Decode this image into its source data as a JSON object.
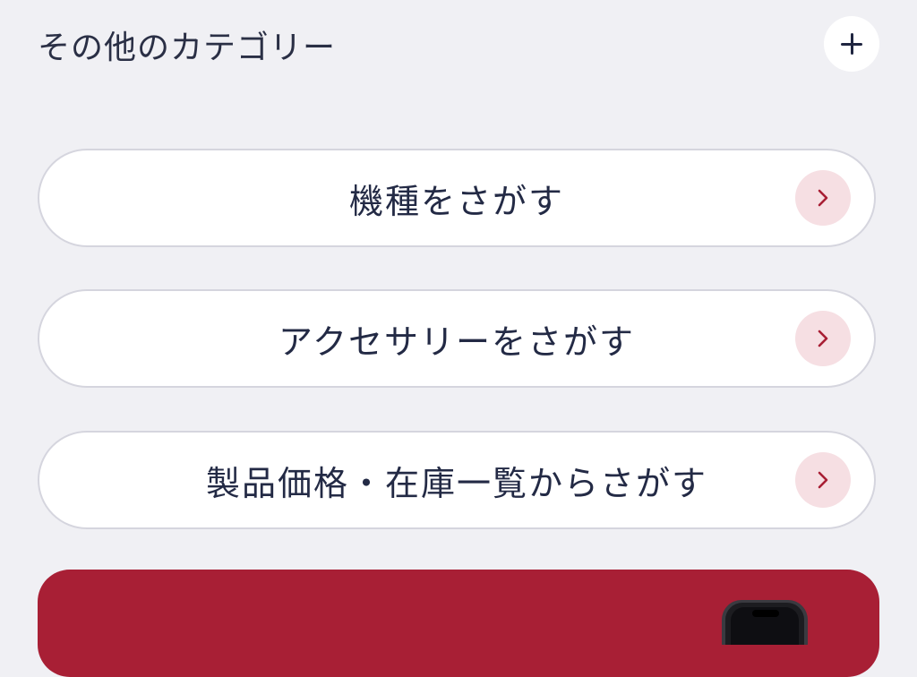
{
  "section": {
    "title": "その他のカテゴリー",
    "expand_icon": "plus-icon"
  },
  "nav_buttons": [
    {
      "label": "機種をさがす",
      "icon": "chevron-right-icon"
    },
    {
      "label": "アクセサリーをさがす",
      "icon": "chevron-right-icon"
    },
    {
      "label": "製品価格・在庫一覧からさがす",
      "icon": "chevron-right-icon"
    }
  ],
  "banner": {
    "icon": "smartphone-icon"
  },
  "colors": {
    "background": "#f0f0f4",
    "text": "#1f2540",
    "accent": "#a81f35",
    "chevron_bg": "#f6dfe3",
    "button_border": "#d5d5de"
  }
}
